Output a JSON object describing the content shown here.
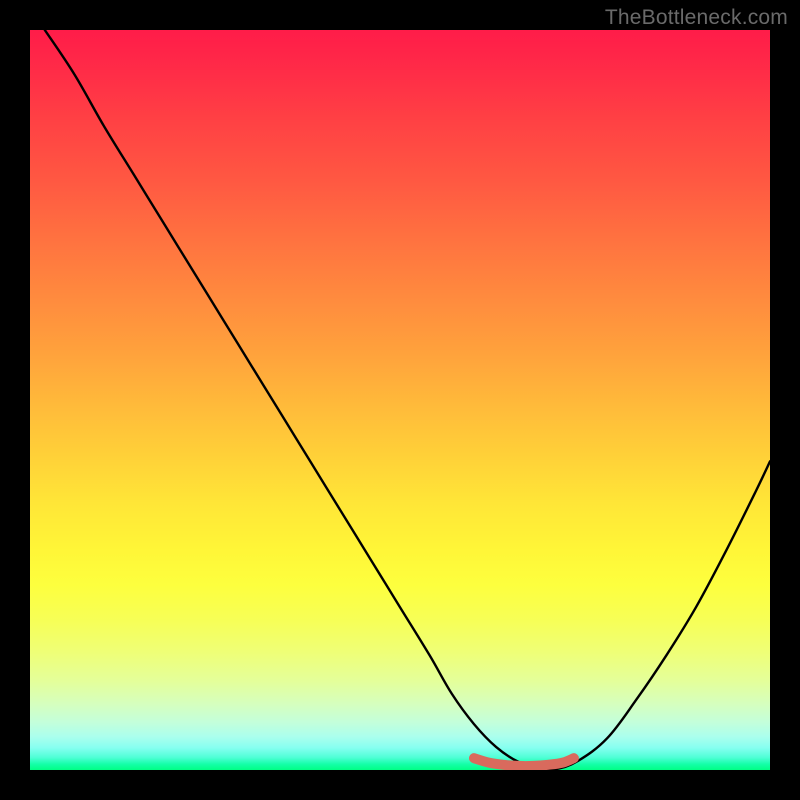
{
  "attribution": "TheBottleneck.com",
  "chart_data": {
    "type": "line",
    "title": "",
    "xlabel": "",
    "ylabel": "",
    "xlim": [
      0,
      100
    ],
    "ylim": [
      0,
      100
    ],
    "series": [
      {
        "name": "curve",
        "x": [
          2,
          6,
          10,
          14,
          18,
          22,
          26,
          30,
          34,
          38,
          42,
          46,
          50,
          54,
          57,
          60,
          63,
          66,
          69,
          71,
          74,
          78,
          82,
          86,
          90,
          94,
          98,
          100
        ],
        "y": [
          100,
          94,
          87,
          80.5,
          74,
          67.5,
          61,
          54.5,
          48,
          41.5,
          35,
          28.5,
          22,
          15.5,
          10.3,
          6.2,
          3.1,
          1.1,
          0.1,
          0.1,
          1.2,
          4.3,
          9.6,
          15.5,
          22,
          29.5,
          37.5,
          41.7
        ]
      },
      {
        "name": "highlight-segment",
        "x": [
          60,
          62,
          64,
          66,
          68,
          70,
          72,
          73.5
        ],
        "y": [
          1.6,
          1.0,
          0.7,
          0.55,
          0.55,
          0.7,
          1.0,
          1.6
        ]
      }
    ],
    "colors": {
      "curve": "#000000",
      "highlight": "#d96a5d",
      "gradient_top": "#ff1c49",
      "gradient_bottom": "#00ff85"
    }
  }
}
